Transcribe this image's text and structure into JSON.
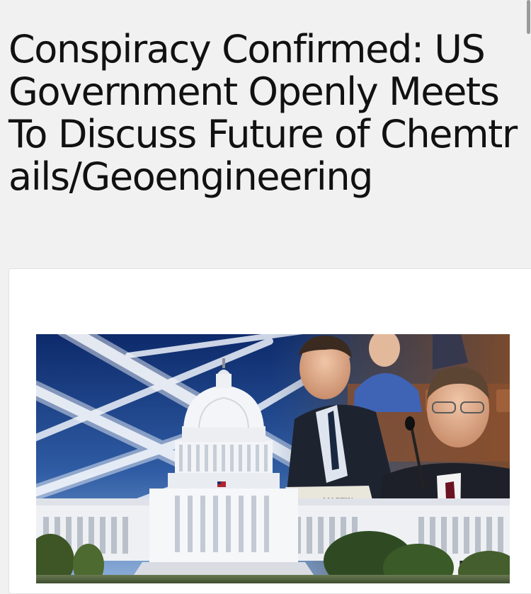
{
  "article": {
    "title": "Conspiracy Confirmed: US Government Openly Meets To Discuss Future of Chemtrails/Geoengineering",
    "image": {
      "alt": "Composite of the US Capitol under chemtrail-crossed sky with two men at a congressional hearing",
      "nameplate_text": "MARTIN"
    }
  }
}
